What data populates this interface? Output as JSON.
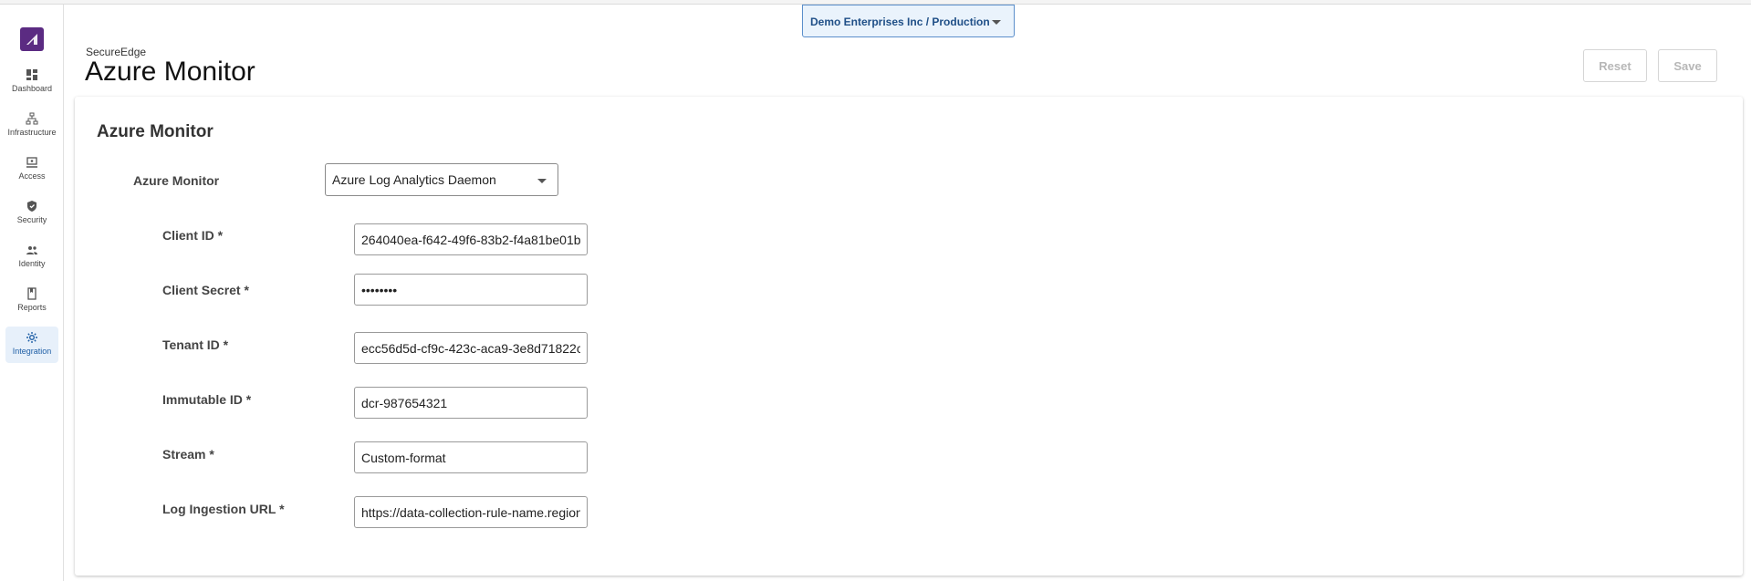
{
  "tenant_selector": {
    "label": "Demo Enterprises Inc / Production"
  },
  "sidebar": {
    "items": [
      {
        "label": "Dashboard",
        "icon": "dashboard-icon"
      },
      {
        "label": "Infrastructure",
        "icon": "infrastructure-icon"
      },
      {
        "label": "Access",
        "icon": "access-icon"
      },
      {
        "label": "Security",
        "icon": "shield-icon"
      },
      {
        "label": "Identity",
        "icon": "users-icon"
      },
      {
        "label": "Reports",
        "icon": "report-icon"
      },
      {
        "label": "Integration",
        "icon": "integration-icon",
        "active": true
      }
    ]
  },
  "header": {
    "breadcrumb": "SecureEdge",
    "title": "Azure Monitor"
  },
  "toolbar": {
    "reset_label": "Reset",
    "save_label": "Save"
  },
  "card": {
    "title": "Azure Monitor",
    "type_label": "Azure Monitor",
    "type_value": "Azure Log Analytics Daemon",
    "fields": [
      {
        "label": "Client ID *",
        "value": "264040ea-f642-49f6-83b2-f4a81be01b"
      },
      {
        "label": "Client Secret *",
        "value": "••••••••"
      },
      {
        "label": "Tenant ID *",
        "value": "ecc56d5d-cf9c-423c-aca9-3e8d71822c"
      },
      {
        "label": "Immutable ID *",
        "value": "dcr-987654321"
      },
      {
        "label": "Stream *",
        "value": "Custom-format"
      },
      {
        "label": "Log Ingestion URL *",
        "value": "https://data-collection-rule-name.region"
      }
    ]
  },
  "colors": {
    "accent": "#1f5fa6",
    "brand": "#5b2b82",
    "active_bg": "#e7f0fa"
  }
}
